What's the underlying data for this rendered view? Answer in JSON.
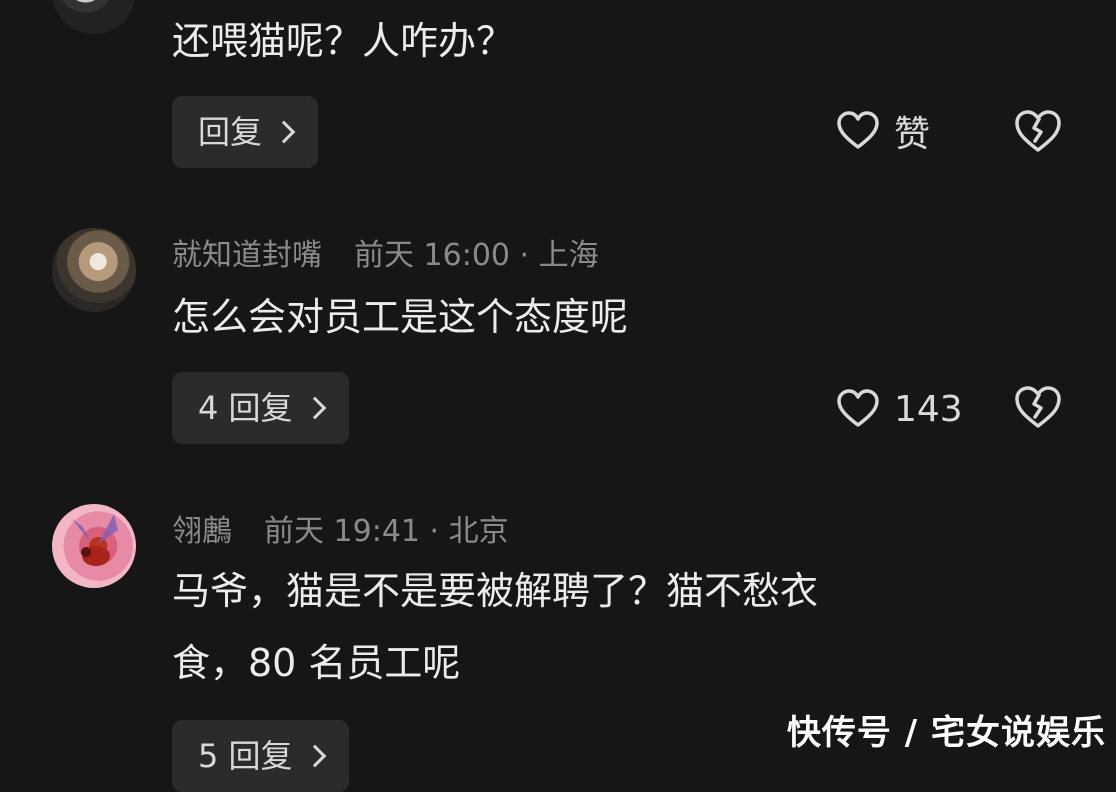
{
  "comments": [
    {
      "username": "",
      "time": "",
      "text": "还喂猫呢？人咋办？",
      "reply_label": "回复",
      "likes_label": "赞"
    },
    {
      "username": "就知道封嘴",
      "time": "前天 16:00 · 上海",
      "text": "怎么会对员工是这个态度呢",
      "reply_label": "4 回复",
      "likes_label": "143"
    },
    {
      "username": "翎鶶",
      "time": "前天 19:41 · 北京",
      "text_line1": "马爷，猫是不是要被解聘了？猫不愁衣",
      "text_line2": "食，80 名员工呢",
      "reply_label": "5 回复"
    }
  ],
  "watermark": "快传号 / 宅女说娱乐",
  "icons": {
    "like": "heart-outline-icon",
    "dislike": "broken-heart-icon",
    "reply": "chevron-right-icon"
  },
  "colors": {
    "background": "#161616",
    "text": "#ececec",
    "meta": "#8a8a8a",
    "button": "#2b2b2b"
  }
}
